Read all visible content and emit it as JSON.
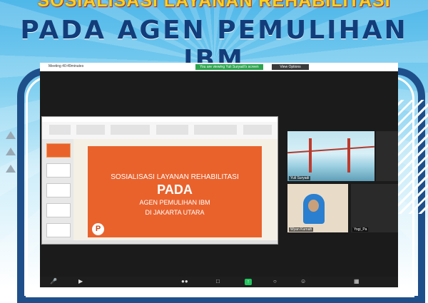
{
  "banner": {
    "line1": "SOSIALISASI LAYANAN REHABILITASI",
    "line2": "PADA AGEN PEMULIHAN IBM"
  },
  "zoom": {
    "meeting_status": "Meeting 40:49minutes",
    "viewing_text": "You are viewing Yuli Suryadi's screen",
    "view_options": "View Options",
    "participants": [
      {
        "name": "Yuli Suryadi"
      },
      {
        "name": "Wyan Kurnah"
      },
      {
        "name": "Yogi_Pa"
      }
    ]
  },
  "slide": {
    "line1": "SOSIALISASI LAYANAN REHABILITASI",
    "line2": "PADA",
    "line3": "AGEN PEMULIHAN IBM",
    "line4": "DI JAKARTA UTARA"
  },
  "colors": {
    "frame": "#1f4f8a",
    "slide_orange": "#e9622c",
    "title_yellow": "#f8d21c",
    "title_blue": "#123d7a"
  },
  "icons": [
    "microphone-icon",
    "video-icon",
    "participants-icon",
    "chat-icon",
    "share-screen-icon",
    "record-icon",
    "reactions-icon",
    "apps-icon"
  ]
}
